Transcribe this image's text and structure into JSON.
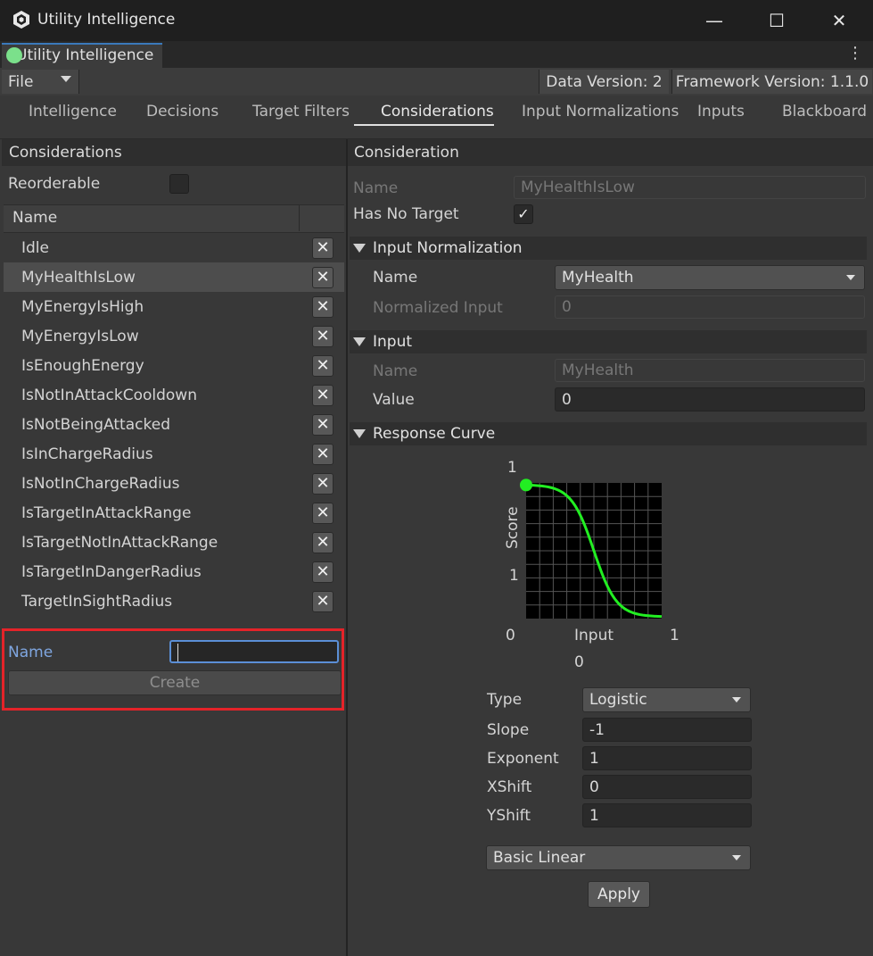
{
  "window": {
    "title": "Utility Intelligence",
    "minimize_glyph": "—",
    "maximize_glyph": "☐",
    "close_glyph": "✕",
    "tab_label": "Utility Intelligence",
    "kebab_glyph": "⋮"
  },
  "toolbar": {
    "file_label": "File",
    "data_version": "Data Version: 2",
    "framework_version": "Framework Version: 1.1.0"
  },
  "nav_tabs": [
    "Intelligence",
    "Decisions",
    "Target Filters",
    "Considerations",
    "Input Normalizations",
    "Inputs",
    "Blackboard"
  ],
  "active_tab": "Considerations",
  "left": {
    "header": "Considerations",
    "reorderable_label": "Reorderable",
    "column_name": "Name",
    "items": [
      "Idle",
      "MyHealthIsLow",
      "MyEnergyIsHigh",
      "MyEnergyIsLow",
      "IsEnoughEnergy",
      "IsNotInAttackCooldown",
      "IsNotBeingAttacked",
      "IsInChargeRadius",
      "IsNotInChargeRadius",
      "IsTargetInAttackRange",
      "IsTargetNotInAttackRange",
      "IsTargetInDangerRadius",
      "TargetInSightRadius"
    ],
    "selected_item": "MyHealthIsLow",
    "delete_glyph": "✕",
    "create": {
      "name_label": "Name",
      "name_value": "",
      "create_button": "Create"
    }
  },
  "right": {
    "header": "Consideration",
    "name_label": "Name",
    "name_value": "MyHealthIsLow",
    "has_no_target_label": "Has No Target",
    "has_no_target_checked": true,
    "check_glyph": "✓",
    "input_normalization": {
      "title": "Input Normalization",
      "name_label": "Name",
      "name_value": "MyHealth",
      "normalized_input_label": "Normalized Input",
      "normalized_input_value": "0"
    },
    "input": {
      "title": "Input",
      "name_label": "Name",
      "name_value": "MyHealth",
      "value_label": "Value",
      "value": "0"
    },
    "response_curve": {
      "title": "Response Curve",
      "y_top": "1",
      "y_mid": "1",
      "y_axis_label": "Score",
      "x_left": "0",
      "x_axis_label": "Input",
      "x_right": "1",
      "x_under": "0",
      "type_label": "Type",
      "type_value": "Logistic",
      "slope_label": "Slope",
      "slope_value": "-1",
      "exponent_label": "Exponent",
      "exponent_value": "1",
      "xshift_label": "XShift",
      "xshift_value": "0",
      "yshift_label": "YShift",
      "yshift_value": "1",
      "preset_value": "Basic Linear",
      "apply_label": "Apply",
      "curve_color": "#22ee22"
    }
  }
}
